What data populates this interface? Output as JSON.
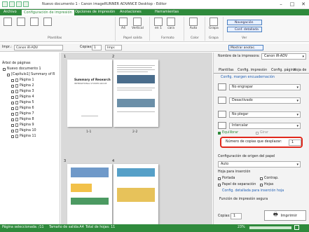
{
  "window": {
    "title": "Nuevo documento 1 - Canon imageRUNNER ADVANCE Desktop - Editor",
    "btn_min": "–",
    "btn_max": "□",
    "btn_close": "✕"
  },
  "tabs": [
    "Archivo",
    "Configuración de impresión",
    "Opciones de impresión",
    "Anotaciones",
    "Herramientas"
  ],
  "ribbon": {
    "pages_per_sheet_size": "A4",
    "orientation": "Vertical",
    "layout_1": "1",
    "layout_1_suffix": "en 1",
    "layout_2": "1",
    "layout_2_suffix": "cara",
    "color": "Auto",
    "staple": "Grapa",
    "navigation": "Navegación",
    "conf_detail": "Conf. detallada",
    "group_plantillas": "Plantillas",
    "group_papel": "Papel salida",
    "group_formato": "Formato",
    "group_color": "Color",
    "group_grapa": "Grapa",
    "group_ver": "Ver"
  },
  "toolbar": {
    "printer_label": "Impr.:",
    "printer_value": "Canon iR-ADV",
    "copies_label": "Copias:",
    "copies_value": "1",
    "print_label": "Impr.",
    "show_annot": "Mostrar anotac."
  },
  "tree": {
    "title": "Árbol de páginas",
    "root": "Nuevo documento 1",
    "chapter": "[Capítulo1] Summary of R",
    "pages": [
      "Página 1",
      "Página 2",
      "Página 3",
      "Página 4",
      "Página 5",
      "Página 6",
      "Página 7",
      "Página 8",
      "Página 9",
      "Página 10",
      "Página 11"
    ]
  },
  "preview": {
    "page_numbers": [
      "1",
      "2",
      "3",
      "4"
    ],
    "sheet_labels": [
      "1-1",
      "2-2"
    ],
    "p1_title": "Summary of Research",
    "p1_sub": "INTERNATIONAL STUDIES GROUP"
  },
  "panel": {
    "printer_label": "Nombre de la impresora:",
    "printer_value": "Canon iR-ADV",
    "tabs": [
      "Plantillas",
      "Config. impresión",
      "Config. página",
      "Hoja de"
    ],
    "link_annotate": "Config. margen encuadernación",
    "combo_1": "No engrapar",
    "combo_2": "Desactivado",
    "combo_3": "No plegar",
    "combo_4": "Intercalar",
    "check_equilibrar": "Equilibrar",
    "check_girar": "Girar",
    "shift_label": "Número de copias que desplazar:",
    "shift_value": "1",
    "paper_source_label": "Configuración de origen del papel",
    "paper_source_value": "Auto",
    "insert_label": "Hoja para inserción",
    "opt_portada": "Portada",
    "opt_contrap": "Contrap.",
    "opt_separacion": "Papel de separación",
    "opt_hojas": "Hojas",
    "link_insert": "Config. detallada para inserción hoja",
    "secure_label": "Función de impresión segura",
    "copies_label": "Copias:",
    "copies_value": "1",
    "print_button": "Imprimir"
  },
  "status": {
    "selected": "Página seleccionada: /11",
    "size": "Tamaño de salida:A4",
    "total": "Total de hojas: 11",
    "zoom": "23%"
  },
  "colors": {
    "brand": "#2f8a3c",
    "highlight": "#e0281c",
    "link": "#1f5fb4"
  }
}
